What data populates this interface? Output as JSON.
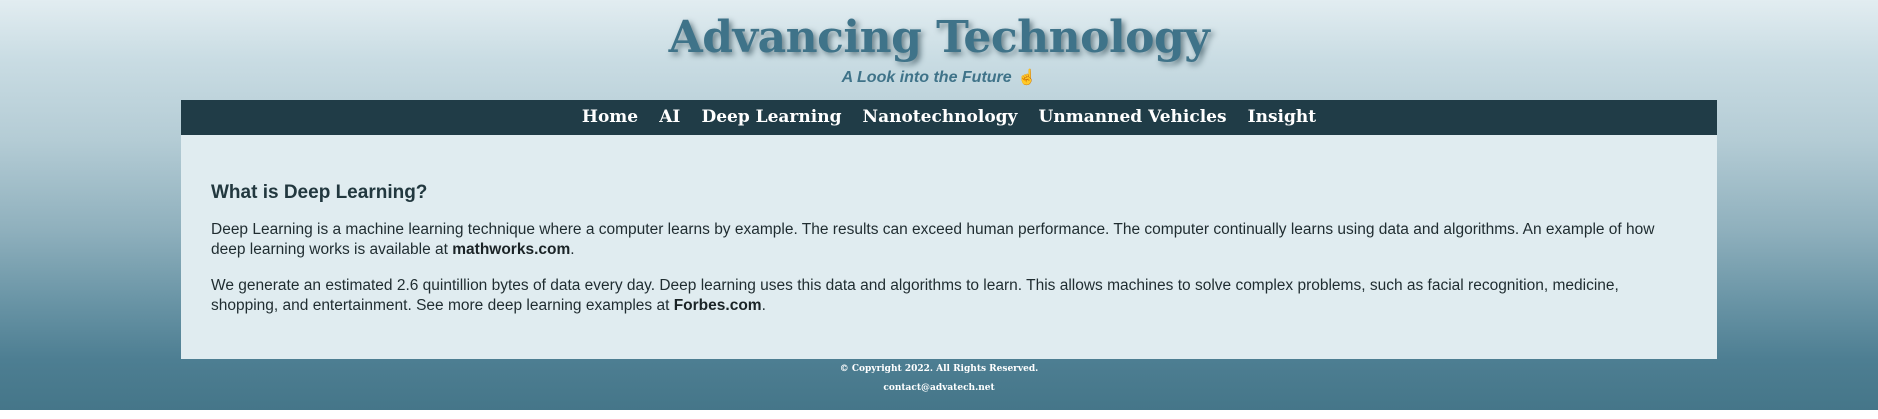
{
  "header": {
    "title": "Advancing Technology",
    "tagline": "A Look into the Future",
    "tagline_icon": "pointing-hand-icon"
  },
  "nav": {
    "items": [
      {
        "label": "Home"
      },
      {
        "label": "AI"
      },
      {
        "label": "Deep Learning"
      },
      {
        "label": "Nanotechnology"
      },
      {
        "label": "Unmanned Vehicles"
      },
      {
        "label": "Insight"
      }
    ]
  },
  "main": {
    "heading": "What is Deep Learning?",
    "paragraph1_text": "Deep Learning is a machine learning technique where a computer learns by example. The results can exceed human performance. The computer continually learns using data and algorithms. An example of how deep learning works is available at ",
    "paragraph1_link": "mathworks.com",
    "paragraph1_end": ".",
    "paragraph2_text": "We generate an estimated 2.6 quintillion bytes of data every day. Deep learning uses this data and algorithms to learn. This allows machines to solve complex problems, such as facial recognition, medicine, shopping, and entertainment. See more deep learning examples at ",
    "paragraph2_link": "Forbes.com",
    "paragraph2_end": "."
  },
  "footer": {
    "copyright": "© Copyright 2022. All Rights Reserved.",
    "email": "contact@advatech.net"
  },
  "colors": {
    "nav_background": "#203c47",
    "content_background": "#e0ecf0",
    "title_color": "#3f7389"
  }
}
